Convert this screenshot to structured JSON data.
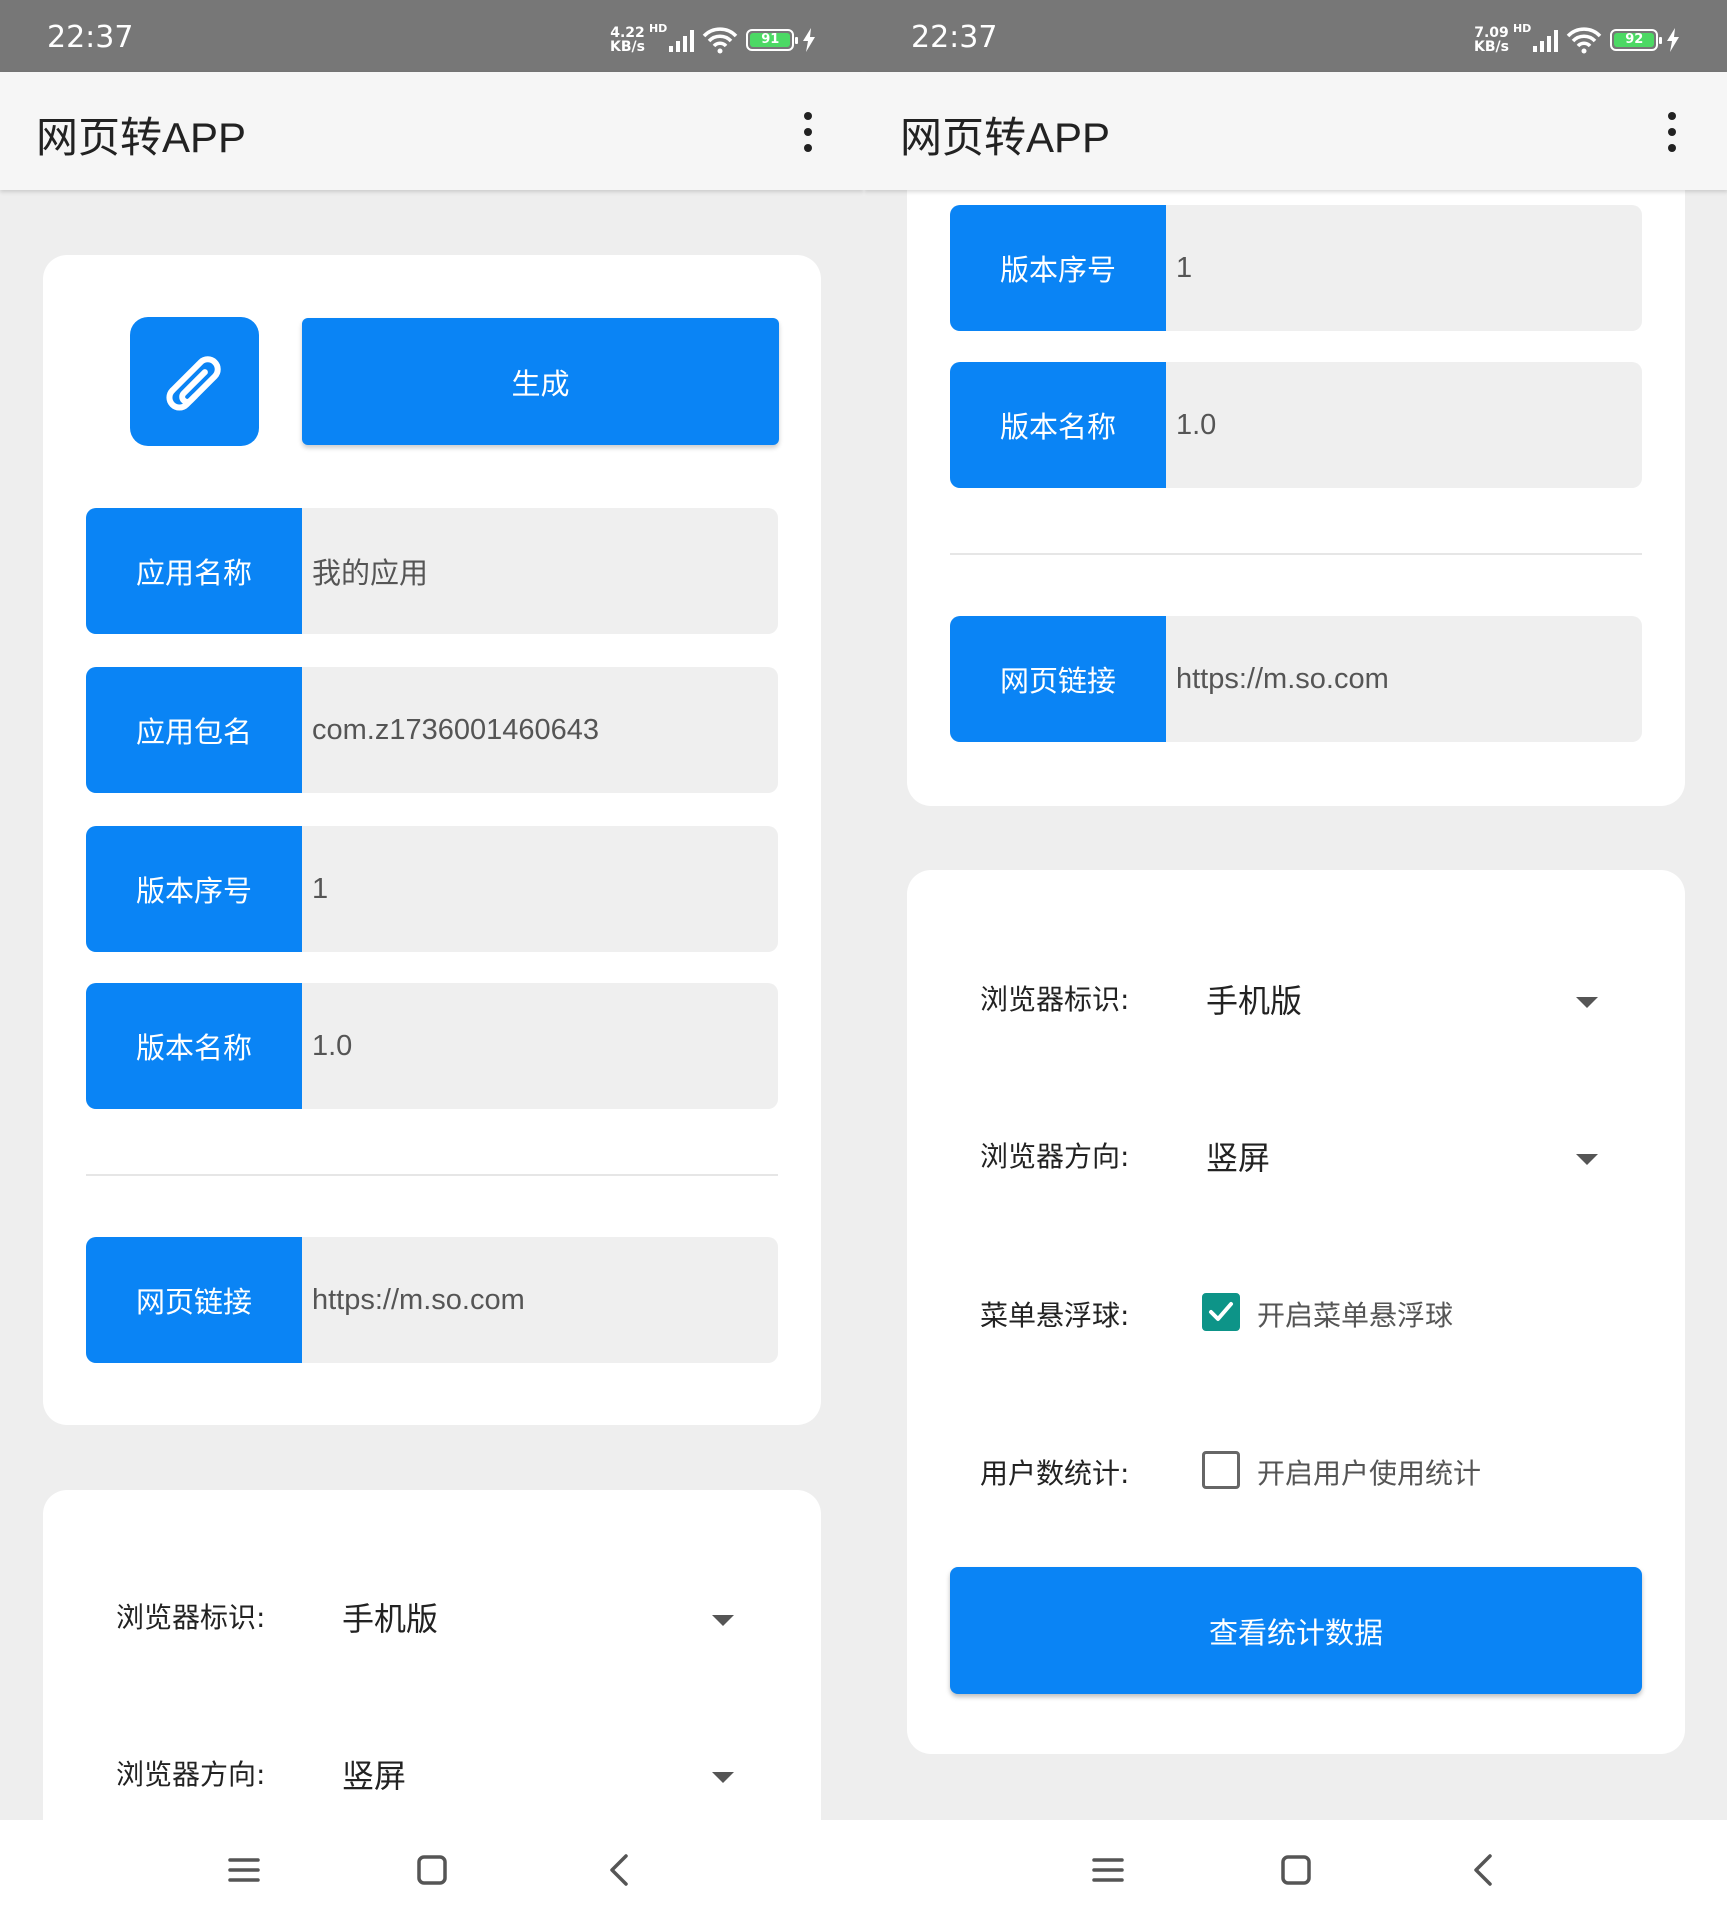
{
  "left": {
    "status": {
      "time": "22:37",
      "speed_value": "4.22",
      "speed_unit": "KB/s",
      "hd": "HD",
      "battery": "91"
    },
    "appbar": {
      "title": "网页转APP"
    },
    "generate_label": "生成",
    "fields": [
      {
        "label": "应用名称",
        "value": "我的应用"
      },
      {
        "label": "应用包名",
        "value": "com.z1736001460643"
      },
      {
        "label": "版本序号",
        "value": "1"
      },
      {
        "label": "版本名称",
        "value": "1.0"
      }
    ],
    "url_field": {
      "label": "网页链接",
      "value": "https://m.so.com"
    },
    "settings": {
      "ua_label": "浏览器标识:",
      "ua_value": "手机版",
      "orient_label": "浏览器方向:",
      "orient_value": "竖屏"
    }
  },
  "right": {
    "status": {
      "time": "22:37",
      "speed_value": "7.09",
      "speed_unit": "KB/s",
      "hd": "HD",
      "battery": "92"
    },
    "appbar": {
      "title": "网页转APP"
    },
    "fields": [
      {
        "label": "版本序号",
        "value": "1"
      },
      {
        "label": "版本名称",
        "value": "1.0"
      }
    ],
    "url_field": {
      "label": "网页链接",
      "value": "https://m.so.com"
    },
    "settings": {
      "ua_label": "浏览器标识:",
      "ua_value": "手机版",
      "orient_label": "浏览器方向:",
      "orient_value": "竖屏",
      "float_label": "菜单悬浮球:",
      "float_check": "开启菜单悬浮球",
      "float_checked": true,
      "stats_label": "用户数统计:",
      "stats_check": "开启用户使用统计",
      "stats_checked": false
    },
    "stats_button": "查看统计数据"
  },
  "colors": {
    "accent": "#0a84f5",
    "checkbox_checked": "#0d9488",
    "statusbar": "#777777",
    "background": "#eeeeee"
  }
}
